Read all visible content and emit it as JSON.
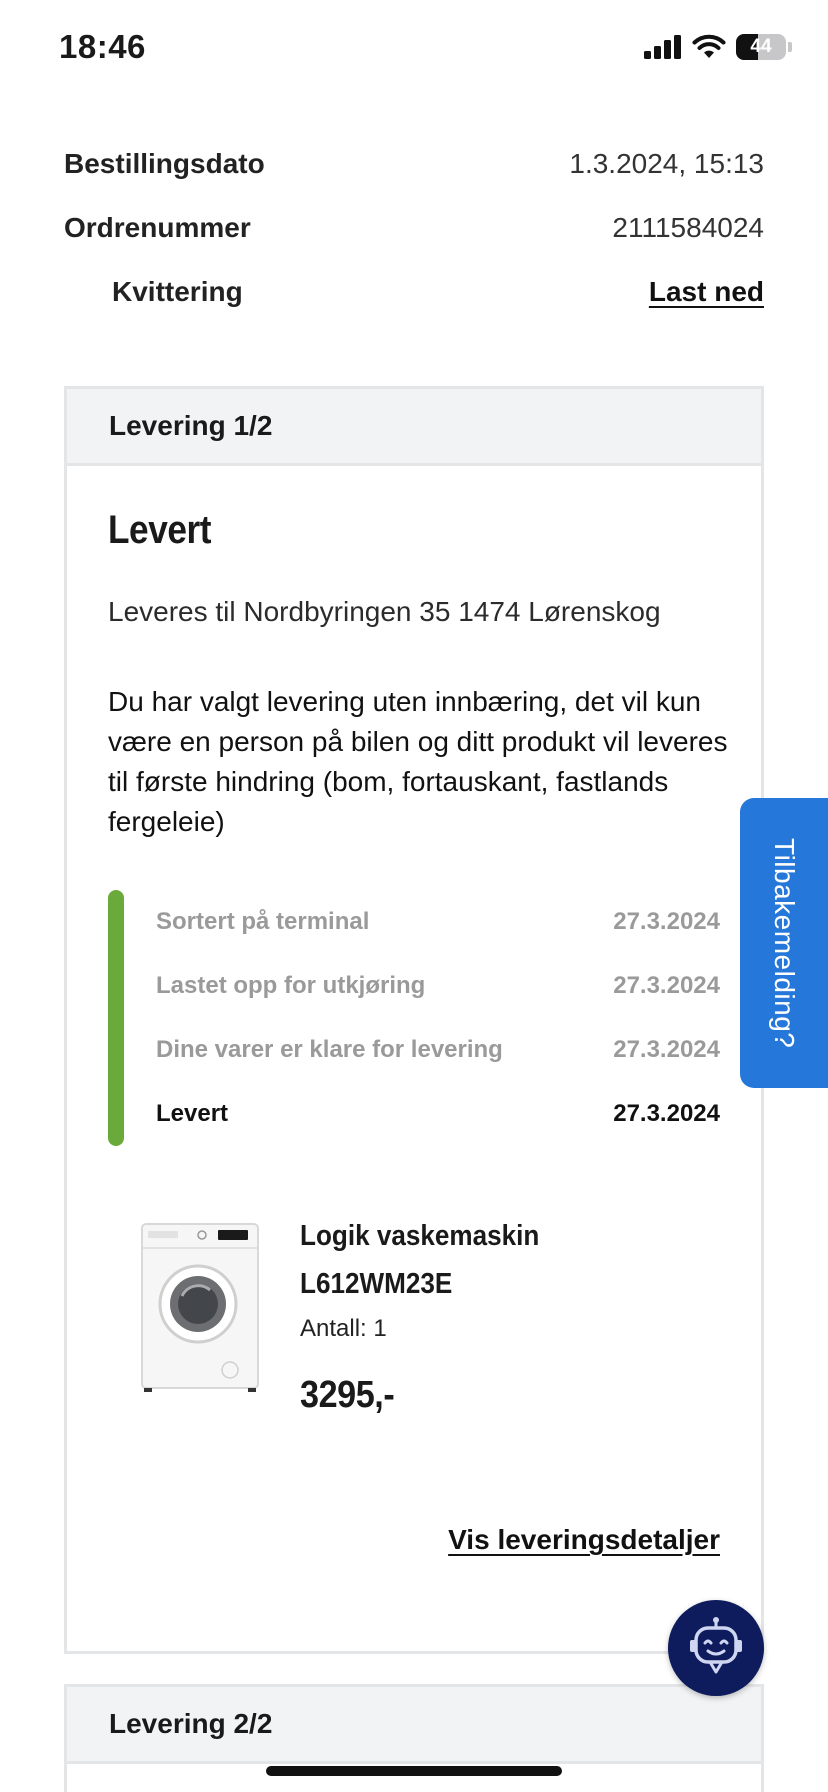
{
  "status_bar": {
    "time": "18:46",
    "battery": "44",
    "battery_level": 0.44
  },
  "order": {
    "date_label": "Bestillingsdato",
    "date_value": "1.3.2024, 15:13",
    "number_label": "Ordrenummer",
    "number_value": "2111584024",
    "receipt_label": "Kvittering",
    "receipt_link": "Last ned"
  },
  "delivery1": {
    "header": "Levering 1/2",
    "status": "Levert",
    "address": "Leveres til Nordbyringen 35 1474 Lørenskog",
    "note": "Du har valgt levering uten innbæring, det vil kun være en person på bilen og ditt produkt vil leveres til første hindring (bom, fortauskant, fastlands fergeleie)",
    "tracking": [
      {
        "label": "Sortert på terminal",
        "date": "27.3.2024"
      },
      {
        "label": "Lastet opp for utkjøring",
        "date": "27.3.2024"
      },
      {
        "label": "Dine varer er klare for levering",
        "date": "27.3.2024"
      },
      {
        "label": "Levert",
        "date": "27.3.2024"
      }
    ],
    "product": {
      "name": "Logik vaskemaskin L612WM23E",
      "quantity": "Antall: 1",
      "price": "3295,-"
    },
    "details_link": "Vis leveringsdetaljer"
  },
  "delivery2": {
    "header": "Levering 2/2"
  },
  "feedback_tab": "Tilbakemelding?",
  "colors": {
    "track_green": "#6aaa3a",
    "feedback_blue": "#2577d9",
    "chatbot_navy": "#0e1b5c"
  }
}
